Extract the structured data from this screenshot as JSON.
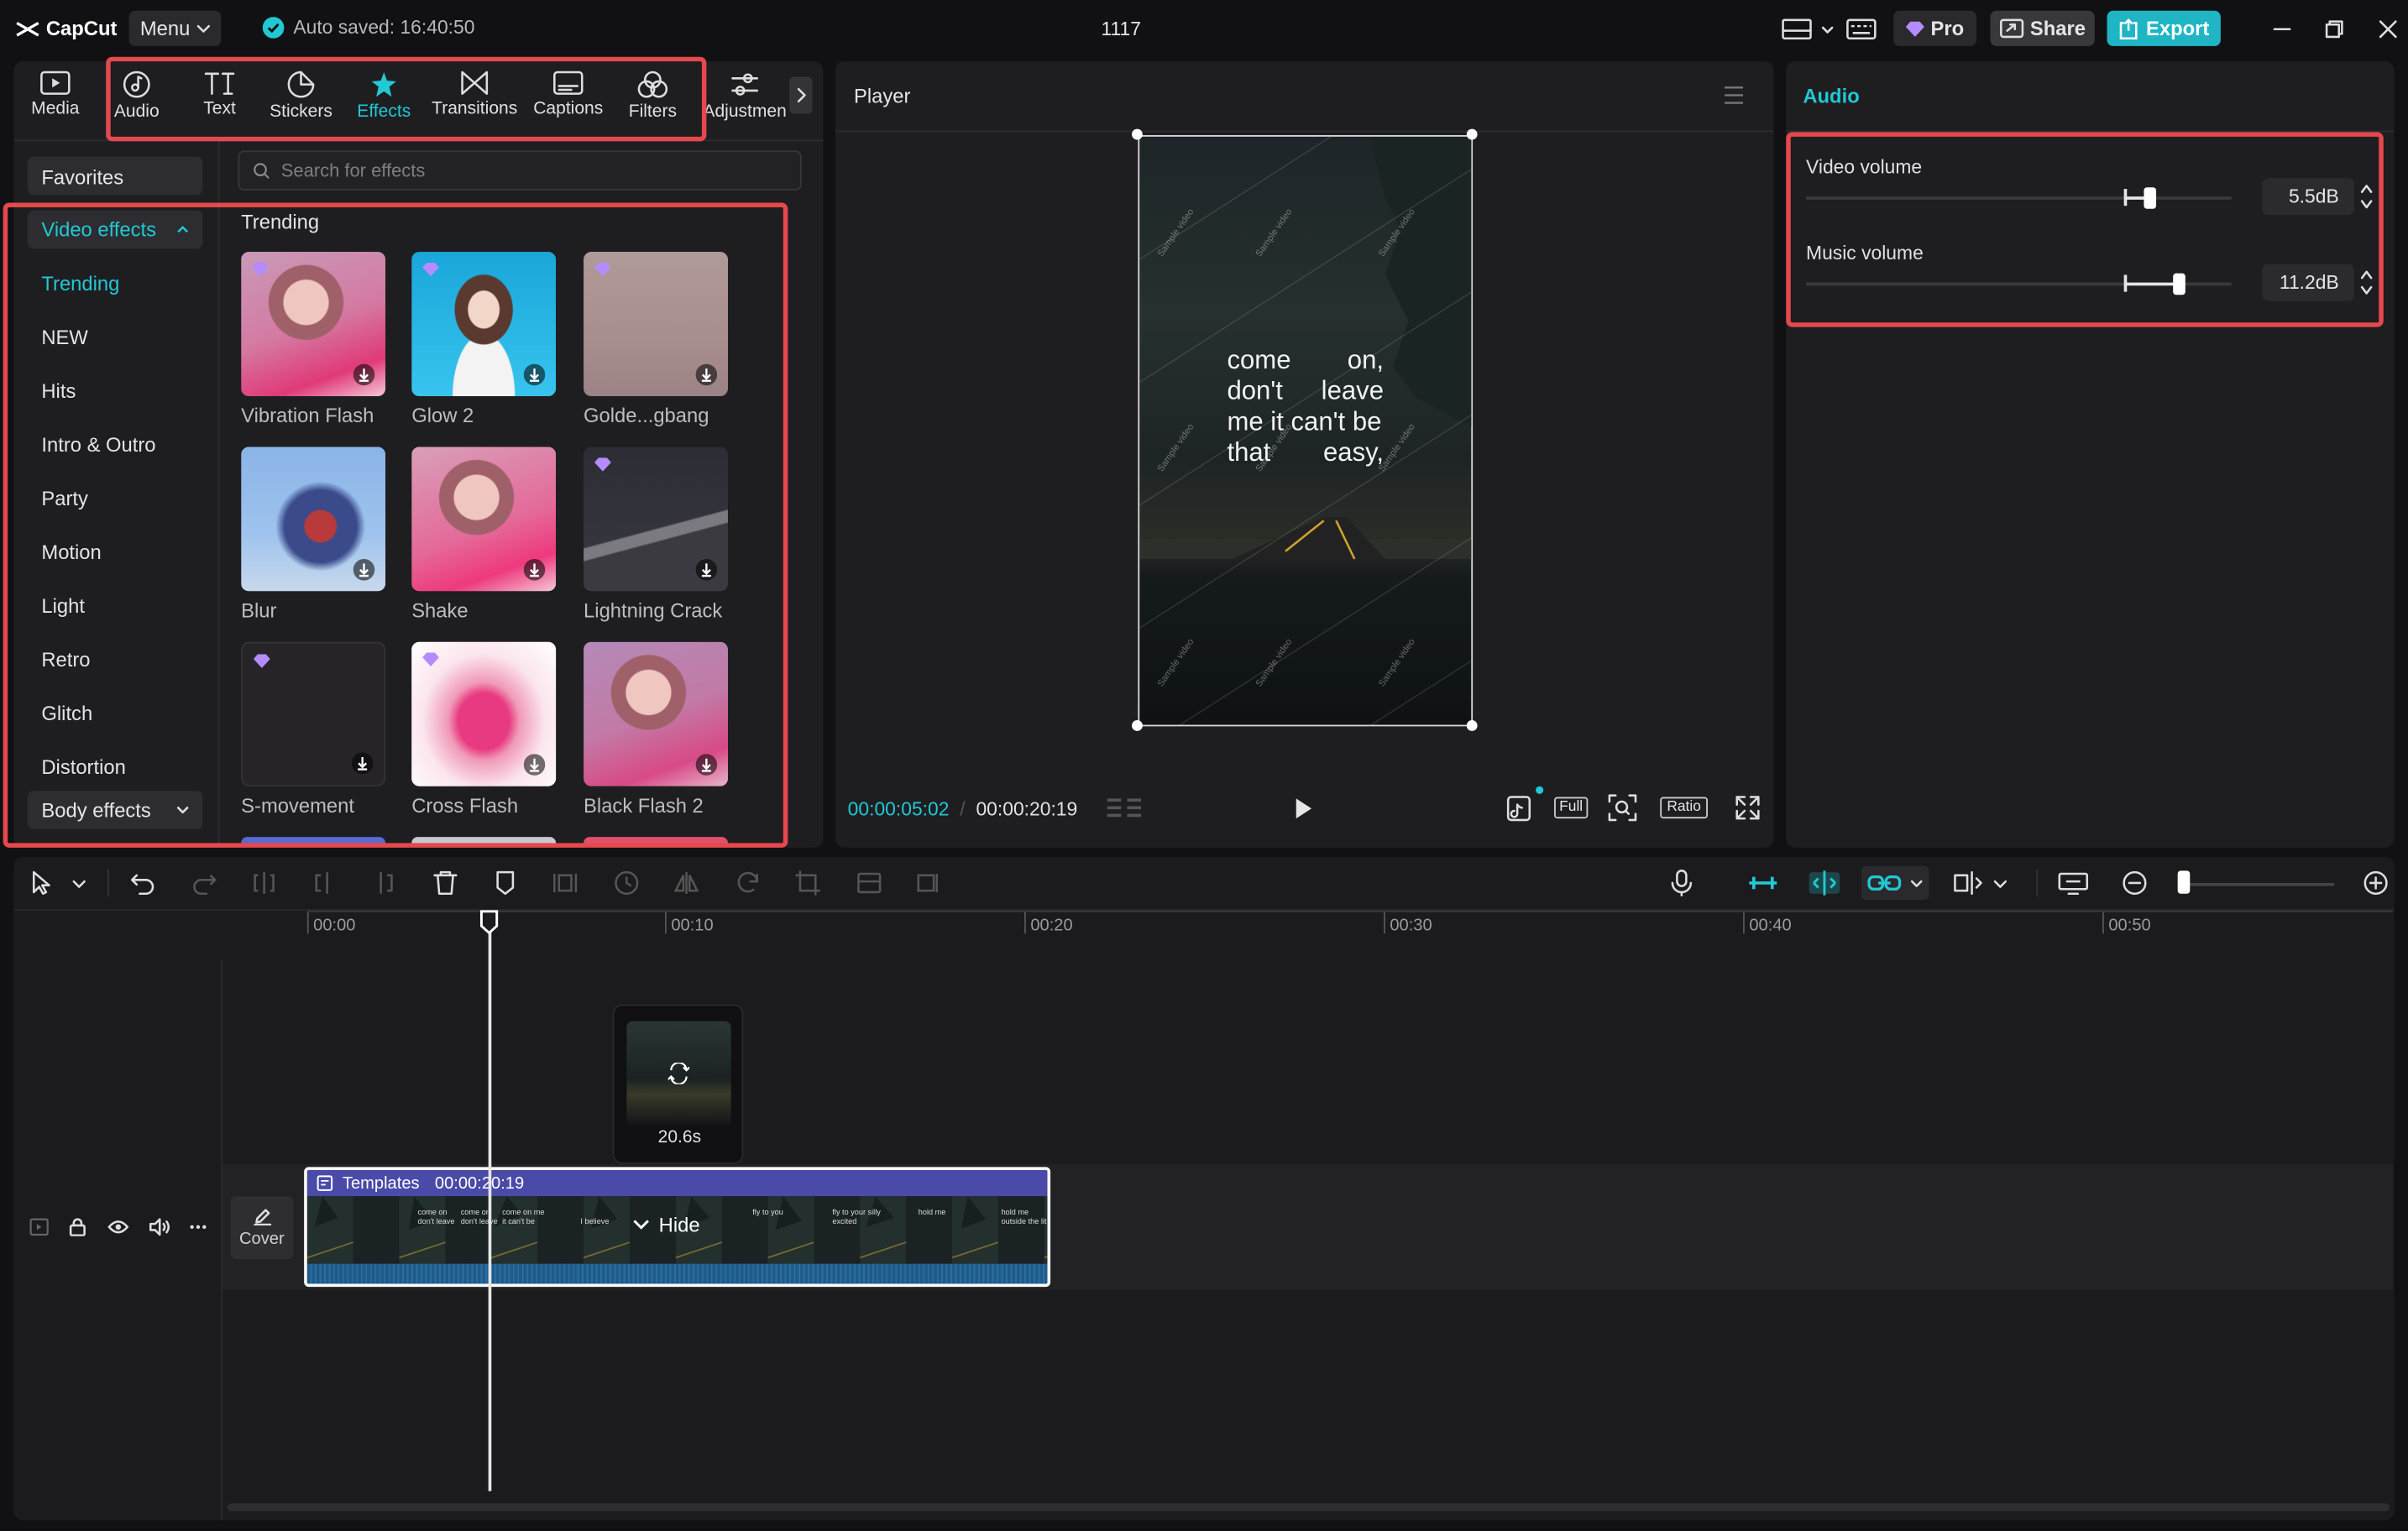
{
  "app": {
    "logo": "CapCut",
    "menu_label": "Menu",
    "autosave": "Auto saved: 16:40:50",
    "project_title": "1117",
    "pro_label": "Pro",
    "share_label": "Share",
    "export_label": "Export",
    "accent": "#22c8d3",
    "highlight": "#e5484d"
  },
  "tools": [
    {
      "label": "Media",
      "icon": "media-icon"
    },
    {
      "label": "Audio",
      "icon": "audio-icon"
    },
    {
      "label": "Text",
      "icon": "text-icon"
    },
    {
      "label": "Stickers",
      "icon": "stickers-icon"
    },
    {
      "label": "Effects",
      "icon": "effects-icon",
      "active": true
    },
    {
      "label": "Transitions",
      "icon": "transitions-icon"
    },
    {
      "label": "Captions",
      "icon": "captions-icon"
    },
    {
      "label": "Filters",
      "icon": "filters-icon"
    },
    {
      "label": "Adjustmen",
      "icon": "adjustment-icon"
    }
  ],
  "sidebar": {
    "favorites": "Favorites",
    "video_effects": "Video effects",
    "categories": [
      "Trending",
      "NEW",
      "Hits",
      "Intro & Outro",
      "Party",
      "Motion",
      "Light",
      "Retro",
      "Glitch",
      "Distortion"
    ],
    "body_effects": "Body effects"
  },
  "search": {
    "placeholder": "Search for effects"
  },
  "section_title": "Trending",
  "effects": [
    {
      "name": "Vibration Flash",
      "pro": true
    },
    {
      "name": "Glow 2",
      "pro": true
    },
    {
      "name": "Golde...gbang",
      "pro": true
    },
    {
      "name": "Blur",
      "pro": false
    },
    {
      "name": "Shake",
      "pro": false
    },
    {
      "name": "Lightning Crack",
      "pro": true
    },
    {
      "name": "S-movement",
      "pro": true
    },
    {
      "name": "Cross Flash",
      "pro": true
    },
    {
      "name": "Black Flash 2",
      "pro": false
    }
  ],
  "player": {
    "title": "Player",
    "caption_lines": [
      [
        "come",
        "on,"
      ],
      [
        "don't",
        "leave"
      ],
      [
        "me it can't be"
      ],
      [
        "that",
        "easy,"
      ]
    ],
    "watermark": "Sample video",
    "current_time": "00:00:05:02",
    "total_time": "00:00:20:19",
    "full_label": "Full",
    "ratio_label": "Ratio"
  },
  "audio_panel": {
    "title": "Audio",
    "video_volume_label": "Video volume",
    "video_volume_value": "5.5dB",
    "music_volume_label": "Music volume",
    "music_volume_value": "11.2dB"
  },
  "timeline": {
    "ruler": [
      "00:00",
      "00:10",
      "00:20",
      "00:30",
      "00:40",
      "00:50"
    ],
    "clip_duration": "20.6s",
    "track_name": "Templates",
    "track_time": "00:00:20:19",
    "hide_label": "Hide",
    "cover_label": "Cover",
    "filmstrip_text": [
      "come on don't leave",
      "come on don't leave",
      "come on me it can't be",
      "I believe",
      "fly to you",
      "fly to your silly excited",
      "hold me",
      "hold me outside the lit"
    ]
  }
}
